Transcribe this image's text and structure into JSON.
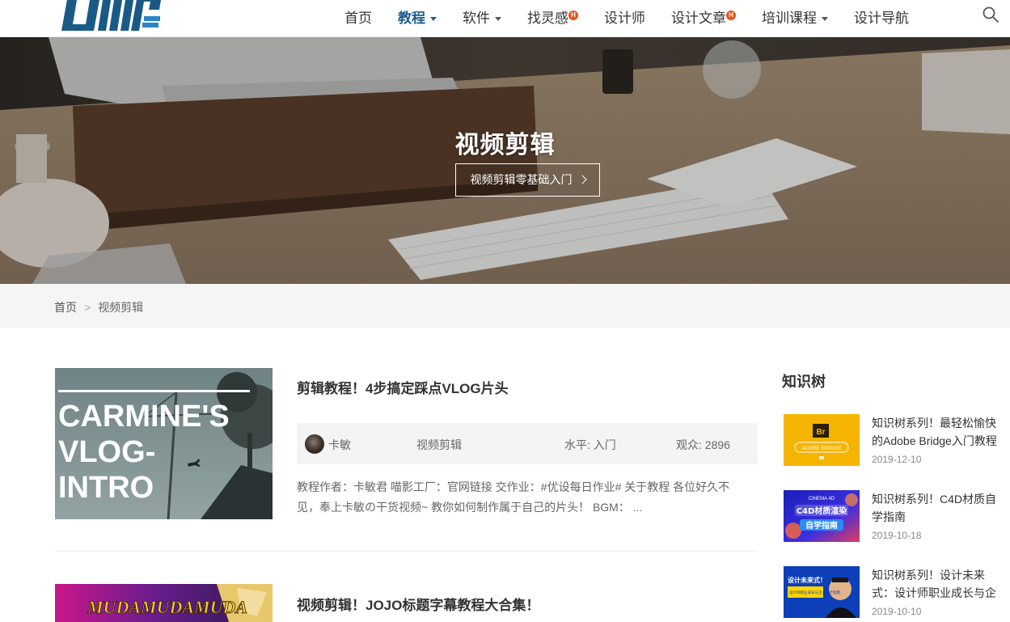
{
  "header": {
    "logo_alt": "UiiiUiii",
    "nav": [
      {
        "label": "首页",
        "dropdown": false,
        "hot": false,
        "active": false
      },
      {
        "label": "教程",
        "dropdown": true,
        "hot": false,
        "active": true
      },
      {
        "label": "软件",
        "dropdown": true,
        "hot": false,
        "active": false
      },
      {
        "label": "找灵感",
        "dropdown": false,
        "hot": true,
        "active": false
      },
      {
        "label": "设计师",
        "dropdown": false,
        "hot": false,
        "active": false
      },
      {
        "label": "设计文章",
        "dropdown": false,
        "hot": true,
        "active": false
      },
      {
        "label": "培训课程",
        "dropdown": true,
        "hot": false,
        "active": false
      },
      {
        "label": "设计导航",
        "dropdown": false,
        "hot": false,
        "active": false
      }
    ],
    "hot_badge": "H",
    "search_icon": "search-icon"
  },
  "hero": {
    "title": "视频剪辑",
    "button_label": "视频剪辑零基础入门"
  },
  "breadcrumb": {
    "home": "首页",
    "separator": ">",
    "current": "视频剪辑"
  },
  "articles": [
    {
      "title": "剪辑教程！4步搞定踩点VLOG片头",
      "thumb_lines": [
        "CARMINE'S",
        "VLOG-",
        "INTRO"
      ],
      "author": "卡敏",
      "category": "视频剪辑",
      "level": "水平: 入门",
      "views": "观众: 2896",
      "excerpt": "教程作者：卡敏君 喵影工厂：官网链接 交作业：#优设每日作业# 关于教程 各位好久不见，奉上卡敏の干货视频~ 教你如何制作属于自己的片头！ BGM： ..."
    },
    {
      "title": "视频剪辑！JOJO标题字幕教程大合集！",
      "thumb_text": "MUDAMUDAMUDA"
    }
  ],
  "sidebar": {
    "title": "知识树",
    "items": [
      {
        "title": "知识树系列！最轻松愉快的Adobe Bridge入门教程",
        "date": "2019-12-10",
        "thumb_badge": "Br",
        "thumb_caption": "ADOBE BRIDGE",
        "color": "#f5b400"
      },
      {
        "title": "知识树系列！C4D材质自学指南",
        "date": "2019-10-18",
        "thumb_top": "CINEMA 4D",
        "thumb_main": "C4D材质渲染",
        "thumb_sub": "自学指南",
        "color": "#2a2fd0"
      },
      {
        "title": "知识树系列！设计未来式：设计师职业成长与企业需求",
        "date": "2019-10-10",
        "thumb_main": "设计未来式！",
        "thumb_sub": "设计师职业成长与企业设计指南",
        "color": "#0d3fb8"
      }
    ]
  }
}
